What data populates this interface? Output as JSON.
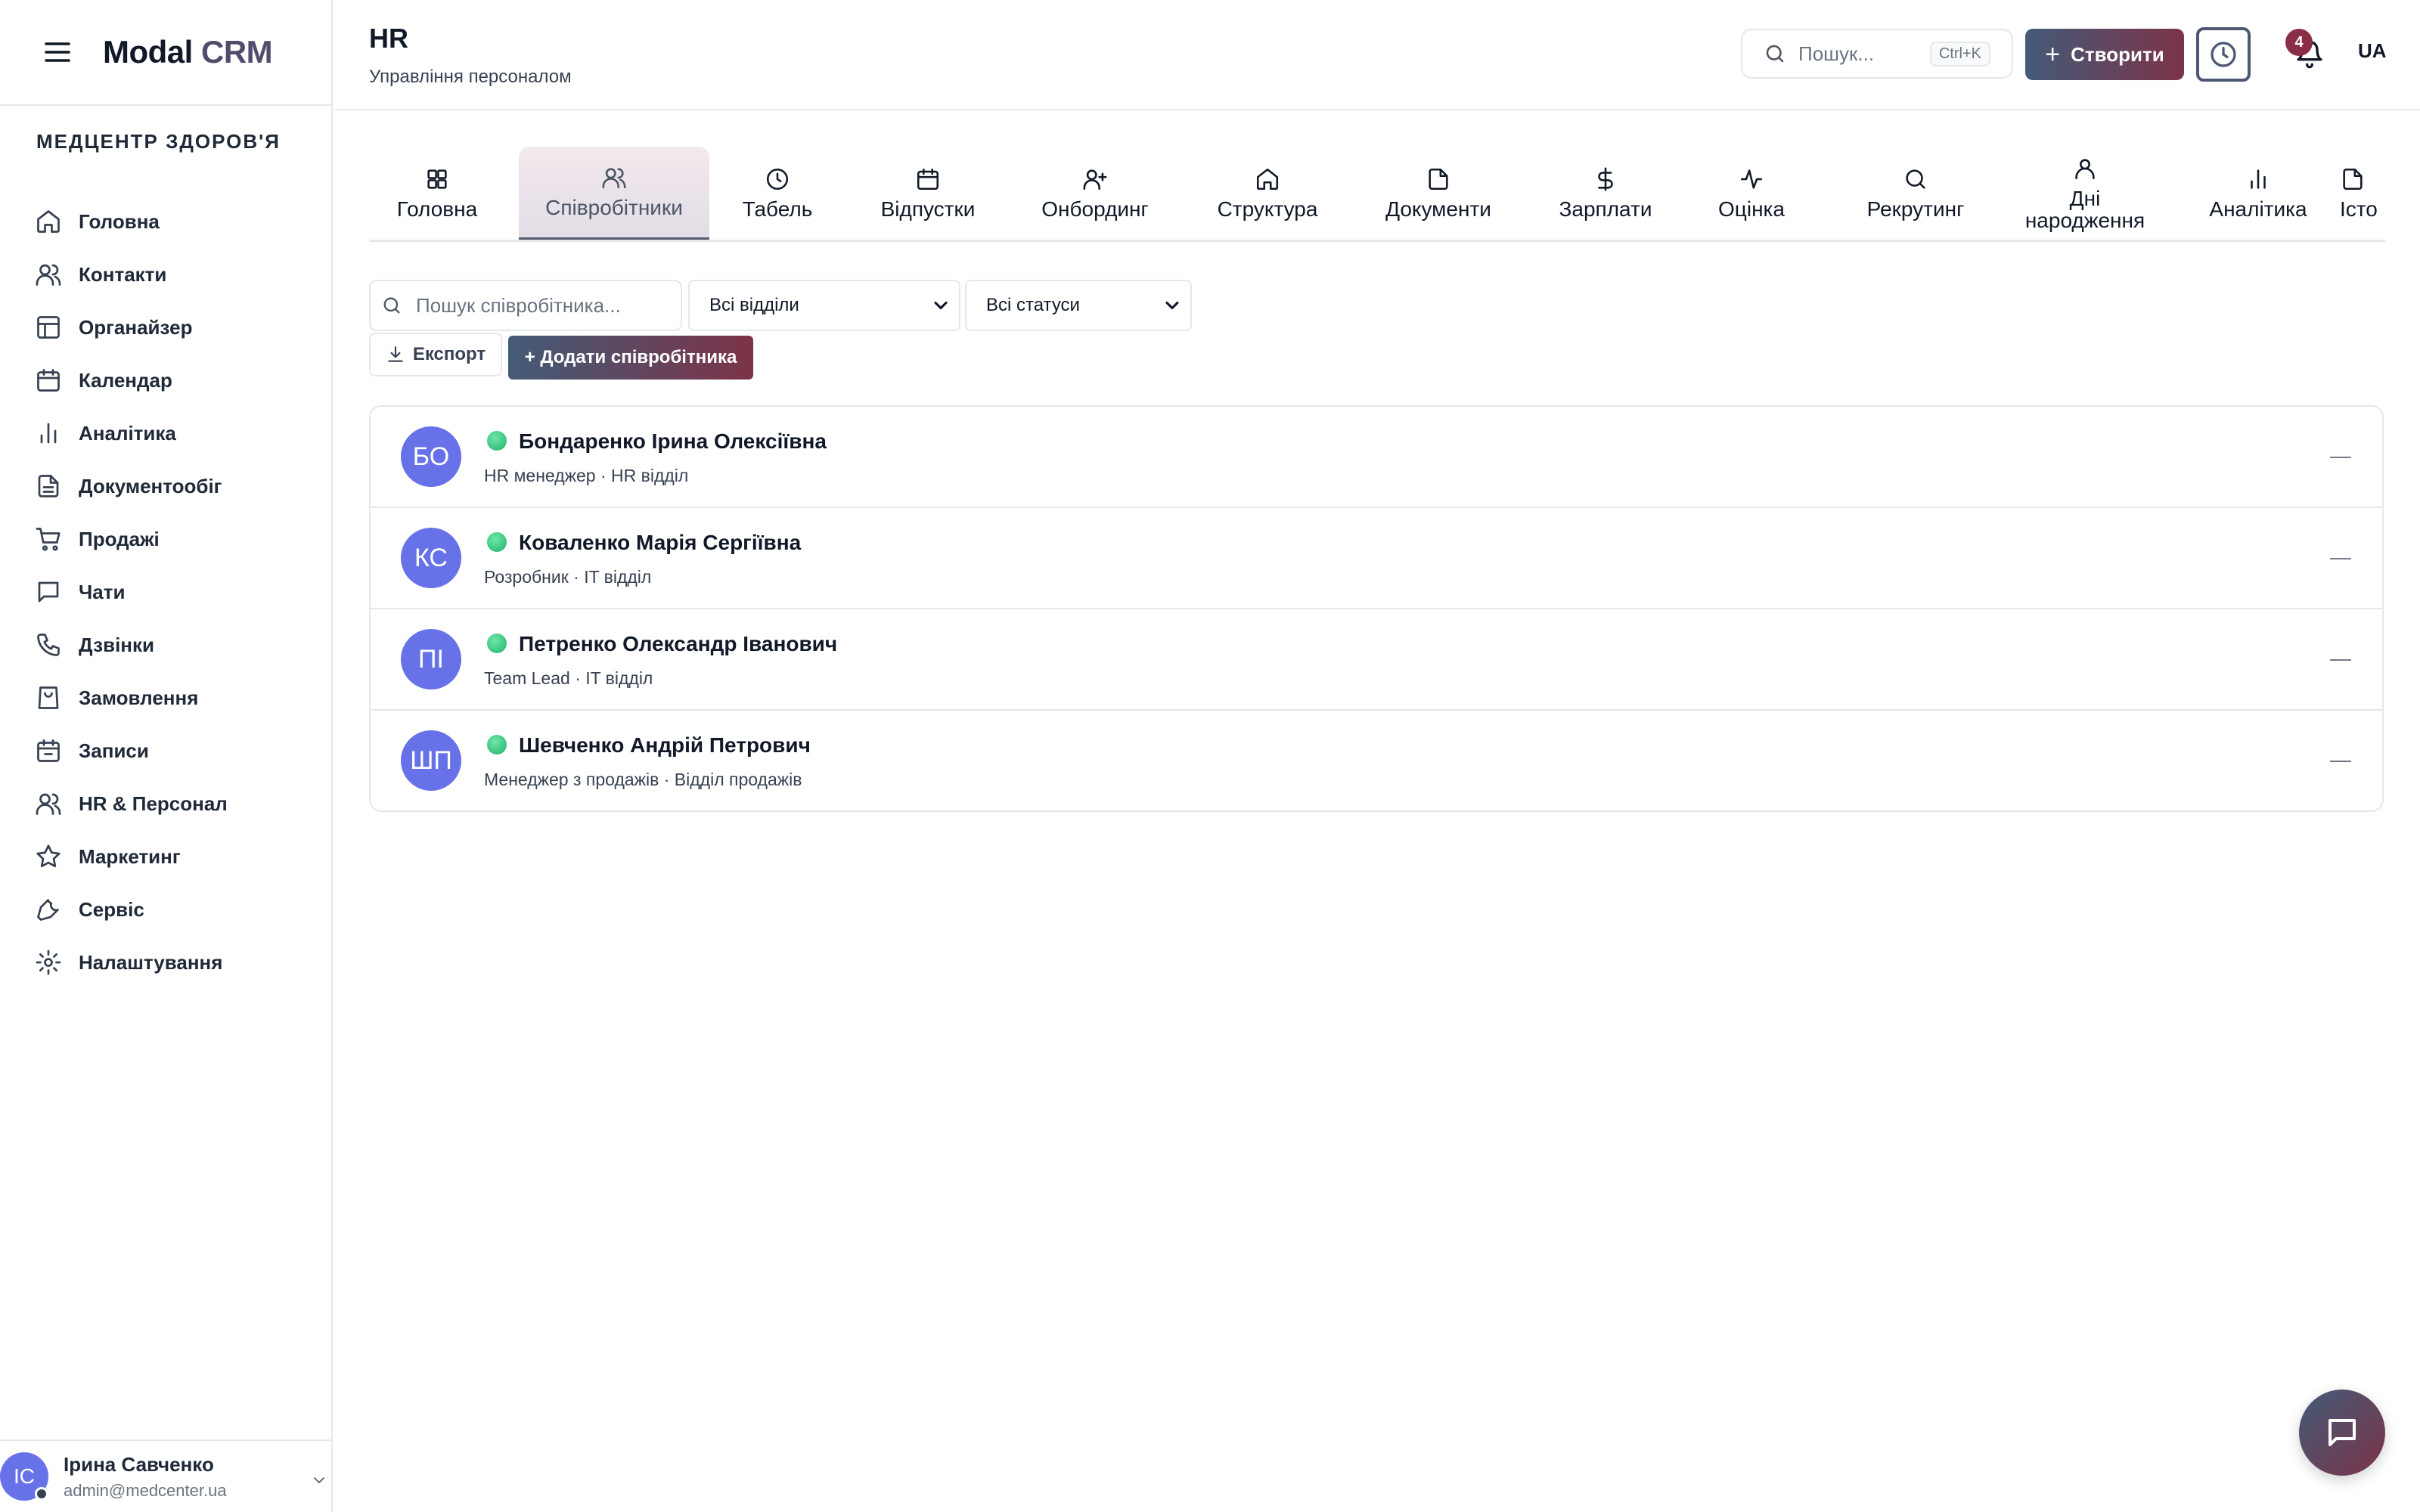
{
  "sidebar": {
    "logo_main": "Modal",
    "logo_accent": "CRM",
    "org_name": "МЕДЦЕНТР ЗДОРОВ'Я",
    "items": [
      {
        "label": "Головна",
        "icon": "home-icon"
      },
      {
        "label": "Контакти",
        "icon": "users-icon"
      },
      {
        "label": "Органайзер",
        "icon": "layout-icon"
      },
      {
        "label": "Календар",
        "icon": "calendar-icon"
      },
      {
        "label": "Аналітика",
        "icon": "bar-chart-icon"
      },
      {
        "label": "Документообіг",
        "icon": "document-icon"
      },
      {
        "label": "Продажі",
        "icon": "cart-icon"
      },
      {
        "label": "Чати",
        "icon": "message-icon"
      },
      {
        "label": "Дзвінки",
        "icon": "phone-icon"
      },
      {
        "label": "Замовлення",
        "icon": "shopping-bag-icon"
      },
      {
        "label": "Записи",
        "icon": "calendar-check-icon"
      },
      {
        "label": "HR & Персонал",
        "icon": "users-icon"
      },
      {
        "label": "Маркетинг",
        "icon": "star-icon"
      },
      {
        "label": "Сервіс",
        "icon": "wrench-icon"
      },
      {
        "label": "Налаштування",
        "icon": "gear-icon"
      }
    ],
    "user": {
      "initials": "ІС",
      "name": "Ірина Савченко",
      "email": "admin@medcenter.ua"
    }
  },
  "header": {
    "title": "HR",
    "subtitle": "Управління персоналом",
    "search_placeholder": "Пошук...",
    "search_shortcut": "Ctrl+K",
    "create_label": "Створити",
    "notification_count": "4",
    "language": "UA"
  },
  "tabs": [
    {
      "label": "Головна",
      "icon": "grid-icon",
      "active": false
    },
    {
      "label": "Співробітники",
      "icon": "users-icon",
      "active": true
    },
    {
      "label": "Табель",
      "icon": "clock-icon",
      "active": false
    },
    {
      "label": "Відпустки",
      "icon": "calendar-icon",
      "active": false
    },
    {
      "label": "Онбординг",
      "icon": "user-plus-icon",
      "active": false
    },
    {
      "label": "Структура",
      "icon": "home-icon",
      "active": false
    },
    {
      "label": "Документи",
      "icon": "file-icon",
      "active": false
    },
    {
      "label": "Зарплати",
      "icon": "dollar-icon",
      "active": false
    },
    {
      "label": "Оцінка",
      "icon": "activity-icon",
      "active": false
    },
    {
      "label": "Рекрутинг",
      "icon": "search-icon",
      "active": false
    },
    {
      "label": "Дні народження",
      "icon": "user-icon",
      "active": false
    },
    {
      "label": "Аналітика",
      "icon": "bar-chart-icon",
      "active": false
    },
    {
      "label": "Істо",
      "icon": "file-icon",
      "active": false
    }
  ],
  "filters": {
    "search_placeholder": "Пошук співробітника...",
    "department": "Всі відділи",
    "status": "Всі статуси",
    "export_label": "Експорт",
    "add_label": "+ Додати співробітника"
  },
  "employees": [
    {
      "initials": "БО",
      "name": "Бондаренко Ірина Олексіївна",
      "meta": "HR менеджер · HR відділ",
      "more": "—"
    },
    {
      "initials": "КС",
      "name": "Коваленко Марія Сергіївна",
      "meta": "Розробник · IT відділ",
      "more": "—"
    },
    {
      "initials": "ПІ",
      "name": "Петренко Олександр Іванович",
      "meta": "Team Lead · IT відділ",
      "more": "—"
    },
    {
      "initials": "ШП",
      "name": "Шевченко Андрій Петрович",
      "meta": "Менеджер з продажів · Відділ продажів",
      "more": "—"
    }
  ],
  "colors": {
    "accent_gradient_start": "#435b78",
    "accent_gradient_end": "#7c3348",
    "avatar": "#6772e8",
    "status_online": "#22b16a",
    "badge": "#8a2e47"
  }
}
